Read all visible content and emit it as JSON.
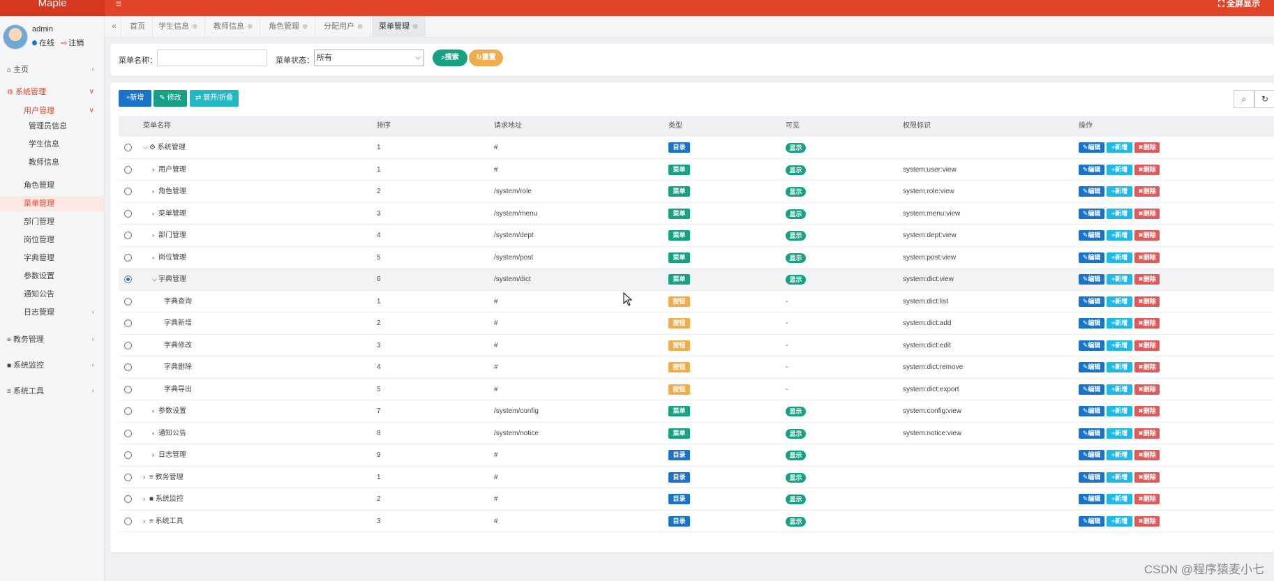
{
  "app": {
    "title": "Maple",
    "menu_icon": "hamburger-icon",
    "fullscreen": "全屏显示",
    "accent": "#e0452a"
  },
  "user": {
    "name": "admin",
    "status": "在线",
    "logout": "注销"
  },
  "sidebar": {
    "items": [
      {
        "label": "主页",
        "icon": "home-icon"
      },
      {
        "label": "系统管理",
        "icon": "gear-icon"
      },
      {
        "label": "用户管理"
      },
      {
        "label": "管理员信息"
      },
      {
        "label": "学生信息"
      },
      {
        "label": "教师信息"
      },
      {
        "label": "角色管理"
      },
      {
        "label": "菜单管理"
      },
      {
        "label": "部门管理"
      },
      {
        "label": "岗位管理"
      },
      {
        "label": "字典管理"
      },
      {
        "label": "参数设置"
      },
      {
        "label": "通知公告"
      },
      {
        "label": "日志管理"
      },
      {
        "label": "教务管理",
        "icon": "list-icon"
      },
      {
        "label": "系统监控",
        "icon": "video-icon"
      },
      {
        "label": "系统工具",
        "icon": "list-icon"
      }
    ]
  },
  "tabs": [
    {
      "label": "首页"
    },
    {
      "label": "学生信息"
    },
    {
      "label": "教师信息"
    },
    {
      "label": "角色管理"
    },
    {
      "label": "分配用户"
    },
    {
      "label": "菜单管理"
    }
  ],
  "search": {
    "name_label": "菜单名称：",
    "name_value": "",
    "status_label": "菜单状态：",
    "status_value": "所有",
    "search_btn": "搜索",
    "reset_btn": "重置"
  },
  "toolbar": {
    "add": "新增",
    "edit": "修改",
    "expand": "展开/折叠"
  },
  "table": {
    "headers": [
      "菜单名称",
      "排序",
      "请求地址",
      "类型",
      "可见",
      "权限标识",
      "操作"
    ],
    "actions": {
      "edit": "编辑",
      "add": "新增",
      "delete": "删除"
    },
    "type_colors": {
      "目录": "#1a73c9",
      "菜单": "#17a084",
      "按钮": "#f0ad4e"
    },
    "rows": [
      {
        "name": "系统管理",
        "order": "1",
        "url": "#",
        "type": "目录",
        "visible": "显示",
        "perm": ""
      },
      {
        "name": "用户管理",
        "order": "1",
        "url": "#",
        "type": "菜单",
        "visible": "显示",
        "perm": "system:user:view"
      },
      {
        "name": "角色管理",
        "order": "2",
        "url": "/system/role",
        "type": "菜单",
        "visible": "显示",
        "perm": "system:role:view"
      },
      {
        "name": "菜单管理",
        "order": "3",
        "url": "/system/menu",
        "type": "菜单",
        "visible": "显示",
        "perm": "system:menu:view"
      },
      {
        "name": "部门管理",
        "order": "4",
        "url": "/system/dept",
        "type": "菜单",
        "visible": "显示",
        "perm": "system:dept:view"
      },
      {
        "name": "岗位管理",
        "order": "5",
        "url": "/system/post",
        "type": "菜单",
        "visible": "显示",
        "perm": "system:post:view"
      },
      {
        "name": "字典管理",
        "order": "6",
        "url": "/system/dict",
        "type": "菜单",
        "visible": "显示",
        "perm": "system:dict:view"
      },
      {
        "name": "字典查询",
        "order": "1",
        "url": "#",
        "type": "按钮",
        "visible": "-",
        "perm": "system:dict:list"
      },
      {
        "name": "字典新增",
        "order": "2",
        "url": "#",
        "type": "按钮",
        "visible": "-",
        "perm": "system:dict:add"
      },
      {
        "name": "字典修改",
        "order": "3",
        "url": "#",
        "type": "按钮",
        "visible": "-",
        "perm": "system:dict:edit"
      },
      {
        "name": "字典删除",
        "order": "4",
        "url": "#",
        "type": "按钮",
        "visible": "-",
        "perm": "system:dict:remove"
      },
      {
        "name": "字典导出",
        "order": "5",
        "url": "#",
        "type": "按钮",
        "visible": "-",
        "perm": "system:dict:export"
      },
      {
        "name": "参数设置",
        "order": "7",
        "url": "/system/config",
        "type": "菜单",
        "visible": "显示",
        "perm": "system:config:view"
      },
      {
        "name": "通知公告",
        "order": "8",
        "url": "/system/notice",
        "type": "菜单",
        "visible": "显示",
        "perm": "system:notice:view"
      },
      {
        "name": "日志管理",
        "order": "9",
        "url": "#",
        "type": "目录",
        "visible": "显示",
        "perm": ""
      },
      {
        "name": "教务管理",
        "order": "1",
        "url": "#",
        "type": "目录",
        "visible": "显示",
        "perm": ""
      },
      {
        "name": "系统监控",
        "order": "2",
        "url": "#",
        "type": "目录",
        "visible": "显示",
        "perm": ""
      },
      {
        "name": "系统工具",
        "order": "3",
        "url": "#",
        "type": "目录",
        "visible": "显示",
        "perm": ""
      }
    ]
  },
  "watermark": "CSDN @程序猿麦小七"
}
